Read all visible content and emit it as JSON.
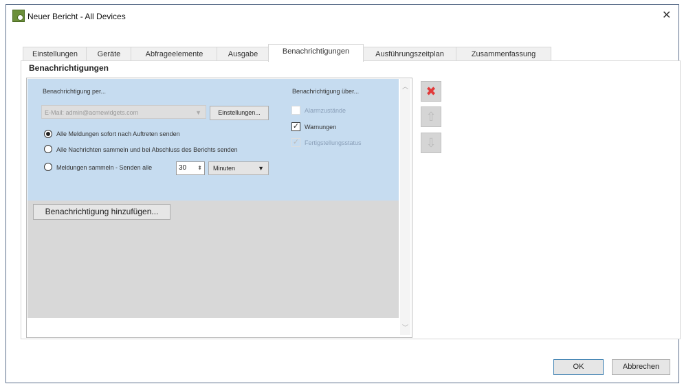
{
  "window": {
    "title": "Neuer Bericht - All Devices",
    "close": "✕"
  },
  "tabs": [
    "Einstellungen",
    "Geräte",
    "Abfrageelemente",
    "Ausgabe",
    "Benachrichtigungen",
    "Ausführungszeitplan",
    "Zusammenfassung"
  ],
  "section_title": "Benachrichtigungen",
  "notification": {
    "via_label": "Benachrichtigung per...",
    "email_value": "E-Mail: admin@acmewidgets.com",
    "settings_button": "Einstellungen...",
    "radios": [
      "Alle Meldungen sofort nach Auftreten senden",
      "Alle Nachrichten sammeln und bei Abschluss des Berichts senden",
      "Meldungen sammeln - Senden alle"
    ],
    "selected_radio": 0,
    "interval_value": "30",
    "interval_unit": "Minuten",
    "about_label": "Benachrichtigung über...",
    "checkboxes": [
      {
        "label": "Alarmzustände",
        "checked": false,
        "disabled": true
      },
      {
        "label": "Warnungen",
        "checked": true,
        "disabled": false
      },
      {
        "label": "Fertigstellungsstatus",
        "checked": true,
        "disabled": true
      }
    ]
  },
  "add_button": "Benachrichtigung hinzufügen...",
  "footer": {
    "ok": "OK",
    "cancel": "Abbrechen"
  },
  "colors": {
    "panel_blue": "#c6dcf0",
    "delete_red": "#e23a3a"
  }
}
